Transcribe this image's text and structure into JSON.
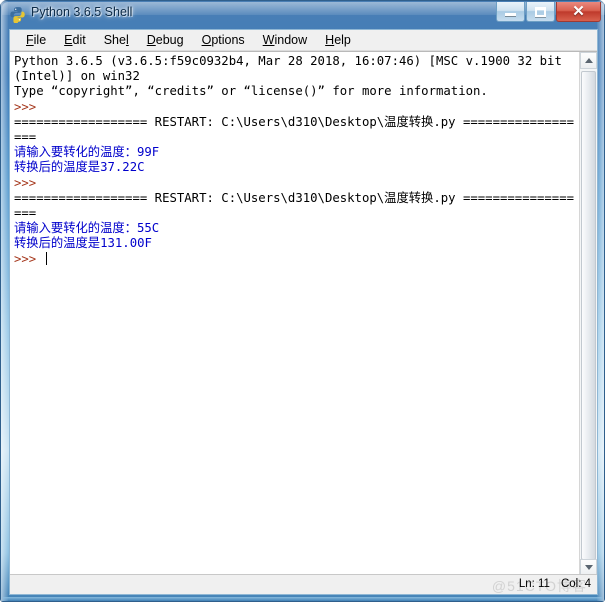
{
  "window": {
    "title": "Python 3.6.5 Shell",
    "icon": "python-logo-icon",
    "controls": {
      "minimize_label": "–",
      "maximize_label": "□",
      "close_label": "✕"
    }
  },
  "menubar": {
    "items": [
      {
        "name": "file",
        "accel": "F",
        "rest": "ile"
      },
      {
        "name": "edit",
        "accel": "E",
        "rest": "dit"
      },
      {
        "name": "shell",
        "pre": "She",
        "accel": "l",
        "rest": ""
      },
      {
        "name": "debug",
        "accel": "D",
        "rest": "ebug"
      },
      {
        "name": "options",
        "accel": "O",
        "rest": "ptions"
      },
      {
        "name": "window",
        "accel": "W",
        "rest": "indow"
      },
      {
        "name": "help",
        "accel": "H",
        "rest": "elp"
      }
    ]
  },
  "shell": {
    "lines": [
      {
        "text": "Python 3.6.5 (v3.6.5:f59c0932b4, Mar 28 2018, 16:07:46) [MSC v.1900 32 bit (Intel)] on win32",
        "color": "black"
      },
      {
        "text": "Type “copyright”, “credits” or “license()” for more information.",
        "color": "black"
      },
      {
        "text": ">>> ",
        "color": "brown"
      },
      {
        "text": "================== RESTART: C:\\Users\\d310\\Desktop\\温度转换.py ==================",
        "color": "black"
      },
      {
        "text": "请输入要转化的温度：99F",
        "color": "blue"
      },
      {
        "text": "转换后的温度是37.22C",
        "color": "blue"
      },
      {
        "text": ">>> ",
        "color": "brown"
      },
      {
        "text": "================== RESTART: C:\\Users\\d310\\Desktop\\温度转换.py ==================",
        "color": "black"
      },
      {
        "text": "请输入要转化的温度：55C",
        "color": "blue"
      },
      {
        "text": "转换后的温度是131.00F",
        "color": "blue"
      },
      {
        "text": ">>> ",
        "color": "brown",
        "caret": true
      }
    ]
  },
  "statusbar": {
    "line_label": "Ln: 11",
    "col_label": "Col: 4",
    "watermark": "@51CTO博客"
  },
  "colors": {
    "prompt": "#a5361b",
    "output": "#0000cc",
    "text": "#000000",
    "title_gradient_top": "#4a7fb5",
    "close_button": "#bf3a2c"
  }
}
